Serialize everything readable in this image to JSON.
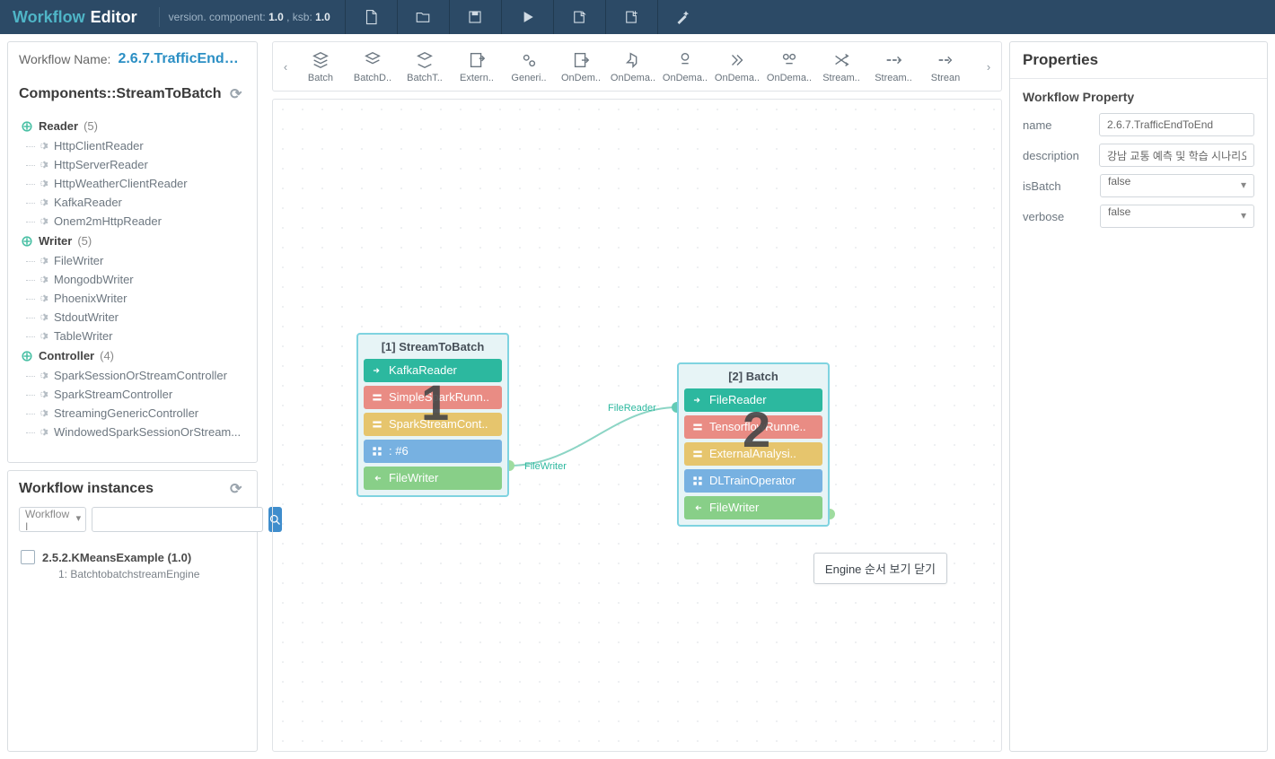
{
  "brand": {
    "a": "Workflow",
    "b": "Editor"
  },
  "version_prefix": "version. component:",
  "version_component": "1.0",
  "version_ksb_prefix": ", ksb:",
  "version_ksb": "1.0",
  "wf_name_label": "Workflow Name:",
  "wf_name_value": "2.6.7.TrafficEndTo…",
  "components_title": "Components::StreamToBatch",
  "tree": {
    "cats": [
      {
        "label": "Reader",
        "count": "(5)",
        "children": [
          "HttpClientReader",
          "HttpServerReader",
          "HttpWeatherClientReader",
          "KafkaReader",
          "Onem2mHttpReader"
        ]
      },
      {
        "label": "Writer",
        "count": "(5)",
        "children": [
          "FileWriter",
          "MongodbWriter",
          "PhoenixWriter",
          "StdoutWriter",
          "TableWriter"
        ]
      },
      {
        "label": "Controller",
        "count": "(4)",
        "children": [
          "SparkSessionOrStreamController",
          "SparkStreamController",
          "StreamingGenericController",
          "WindowedSparkSessionOrStream..."
        ]
      }
    ]
  },
  "instances_title": "Workflow instances",
  "instances_select": "Workflow I",
  "instance0": "2.5.2.KMeansExample (1.0)",
  "instance0_sub": "1: BatchtobatchstreamEngine",
  "toolbar_labels": [
    "Batch",
    "BatchD..",
    "BatchT..",
    "Extern..",
    "Generi..",
    "OnDem..",
    "OnDema..",
    "OnDema..",
    "OnDema..",
    "OnDema..",
    "Stream..",
    "Stream..",
    "Strean"
  ],
  "node1_title": "[1] StreamToBatch",
  "node1_rows": [
    {
      "cls": "bg-teal",
      "txt": "KafkaReader"
    },
    {
      "cls": "bg-red",
      "txt": "SimpleSparkRunn.."
    },
    {
      "cls": "bg-yellow",
      "txt": "SparkStreamCont.."
    },
    {
      "cls": "bg-blue",
      "txt": ": #6"
    },
    {
      "cls": "bg-green",
      "txt": "FileWriter"
    }
  ],
  "node2_title": "[2] Batch",
  "node2_rows": [
    {
      "cls": "bg-teal",
      "txt": "FileReader"
    },
    {
      "cls": "bg-red",
      "txt": "TensorflowRunne.."
    },
    {
      "cls": "bg-yellow",
      "txt": "ExternalAnalysi.."
    },
    {
      "cls": "bg-blue",
      "txt": "DLTrainOperator"
    },
    {
      "cls": "bg-green",
      "txt": "FileWriter"
    }
  ],
  "big1": "1",
  "big2": "2",
  "edge_label_out": "FileWriter",
  "edge_label_in": "FileReader",
  "engine_btn": "Engine 순서 보기 닫기",
  "props_title": "Properties",
  "props_sub": "Workflow Property",
  "props": {
    "name_lbl": "name",
    "name_val": "2.6.7.TrafficEndToEnd",
    "desc_lbl": "description",
    "desc_val": "강남 교통 예측 및 학습 시나리오",
    "isBatch_lbl": "isBatch",
    "isBatch_val": "false",
    "verbose_lbl": "verbose",
    "verbose_val": "false"
  }
}
